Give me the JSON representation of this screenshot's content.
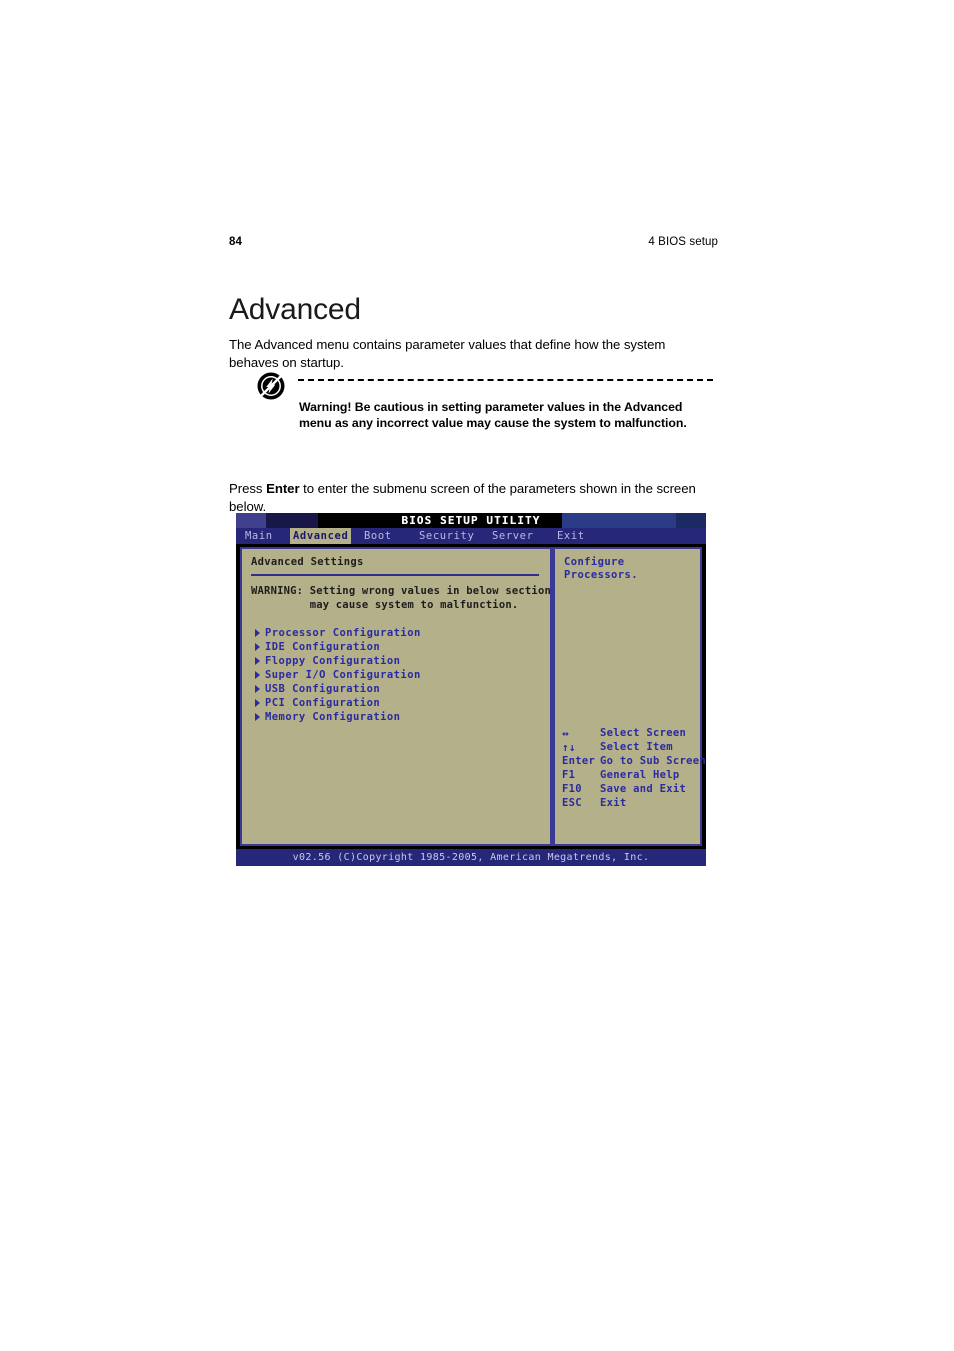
{
  "page": {
    "number": "84",
    "chapter": "4 BIOS setup",
    "title": "Advanced",
    "intro": "The Advanced menu contains parameter values that define how the system behaves on startup."
  },
  "warning_callout": {
    "icon": "electric-shock-warning-icon",
    "text": "Warning! Be cautious in setting parameter values in the Advanced menu as any incorrect value may cause the system to malfunction."
  },
  "press_enter": {
    "before": "Press ",
    "key": "Enter",
    "after": " to enter the submenu screen of the parameters shown in the screen below."
  },
  "bios": {
    "title": "BIOS SETUP UTILITY",
    "menu": [
      {
        "label": "Main",
        "active": false
      },
      {
        "label": "Advanced",
        "active": true
      },
      {
        "label": "Boot",
        "active": false
      },
      {
        "label": "Security",
        "active": false
      },
      {
        "label": "Server",
        "active": false
      },
      {
        "label": "Exit",
        "active": false
      }
    ],
    "left_pane": {
      "heading": "Advanced Settings",
      "warning_line1": "WARNING: Setting wrong values in below sections",
      "warning_line2": "         may cause system to malfunction.",
      "items": [
        "Processor Configuration",
        "IDE Configuration",
        "Floppy Configuration",
        "Super I/O Configuration",
        "USB Configuration",
        "PCI Configuration",
        "Memory Configuration"
      ]
    },
    "right_pane": {
      "help": "Configure Processors.",
      "keys": [
        {
          "key": "↔",
          "desc": "Select Screen"
        },
        {
          "key": "↑↓",
          "desc": "Select Item"
        },
        {
          "key": "Enter",
          "desc": "Go to Sub Screen"
        },
        {
          "key": "F1",
          "desc": "General Help"
        },
        {
          "key": "F10",
          "desc": "Save and Exit"
        },
        {
          "key": "ESC",
          "desc": "Exit"
        }
      ]
    },
    "footer": "v02.56 (C)Copyright 1985-2005, American Megatrends, Inc.",
    "colors": {
      "panel": "#b3b08a",
      "chrome_blue": "#27277a",
      "text_blue": "#2b2ba0",
      "highlight": "#b3b08a"
    }
  }
}
